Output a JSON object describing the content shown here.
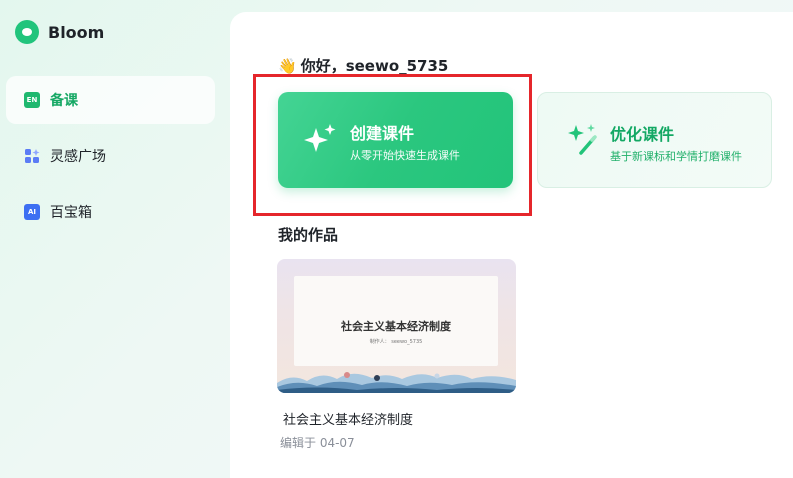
{
  "app": {
    "name": "Bloom"
  },
  "sidebar": {
    "items": [
      {
        "label": "备课",
        "icon": "en-book-icon",
        "icon_text": "EN",
        "active": true
      },
      {
        "label": "灵感广场",
        "icon": "grid-sparkle-icon"
      },
      {
        "label": "百宝箱",
        "icon": "ai-box-icon",
        "icon_text": "AI"
      }
    ]
  },
  "main": {
    "greeting": "你好，seewo_5735",
    "cards": [
      {
        "title": "创建课件",
        "subtitle": "从零开始快速生成课件",
        "icon": "sparkle-icon"
      },
      {
        "title": "优化课件",
        "subtitle": "基于新课标和学情打磨课件",
        "icon": "magic-wand-icon"
      }
    ],
    "works_title": "我的作品",
    "works": [
      {
        "thumb_title": "社会主义基本经济制度",
        "thumb_author": "制作人： seewo_5735",
        "name": "社会主义基本经济制度",
        "date": "编辑于 04-07"
      }
    ]
  },
  "colors": {
    "brand": "#21c47c",
    "highlight": "#e5262b",
    "accent_text": "#16a864"
  }
}
